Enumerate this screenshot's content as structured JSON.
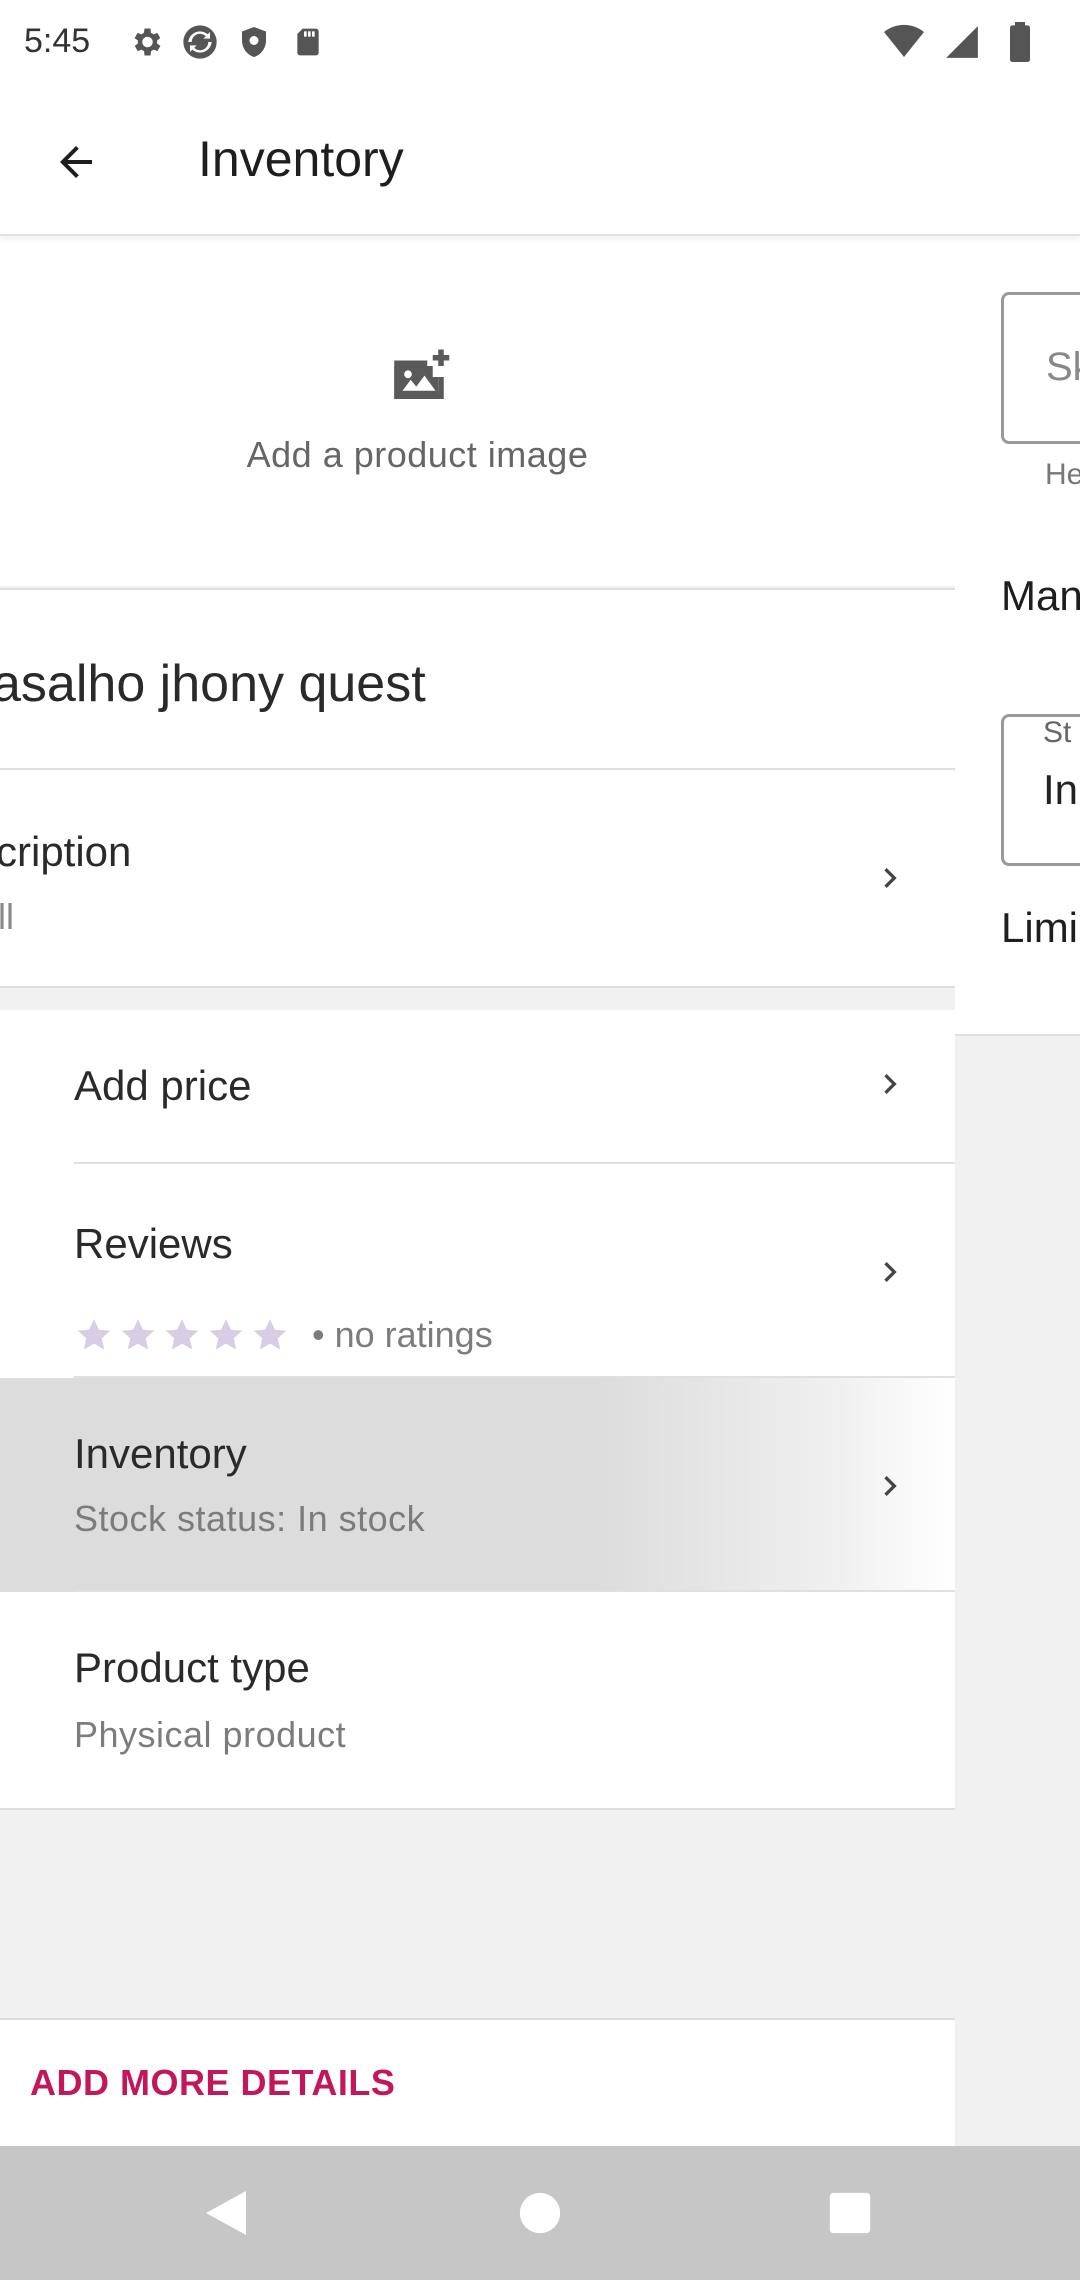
{
  "status_bar": {
    "time": "5:45",
    "left_icons": [
      "gear-icon",
      "sync-icon",
      "shield-icon",
      "sd-card-icon"
    ],
    "right_icons": [
      "wifi-icon",
      "signal-icon",
      "battery-icon"
    ]
  },
  "app_bar": {
    "back_icon": "arrow-left-icon",
    "title": "Inventory"
  },
  "product": {
    "image_placeholder": "Add a product image",
    "title": "asalho jhony quest",
    "description_title": "cription",
    "description_sub": "ll"
  },
  "list": {
    "price": {
      "title": "Add price"
    },
    "reviews": {
      "title": "Reviews",
      "rating_text": "• no ratings",
      "stars": 5,
      "star_color": "#d9cde6"
    },
    "inventory": {
      "title": "Inventory",
      "sub": "Stock status: In stock"
    },
    "product_type": {
      "title": "Product type",
      "sub": "Physical product"
    }
  },
  "footer": {
    "button": "ADD MORE DETAILS",
    "accent": "#c2185b"
  },
  "right_panel": {
    "sku_field_text": "Sk",
    "helper_text": "He",
    "manage_label": "Man",
    "stock_label": "St",
    "stock_value": "In",
    "limit_label": "Limi"
  },
  "nav_bar": {
    "back": "triangle-back-icon",
    "home": "circle-home-icon",
    "recents": "square-recents-icon"
  }
}
